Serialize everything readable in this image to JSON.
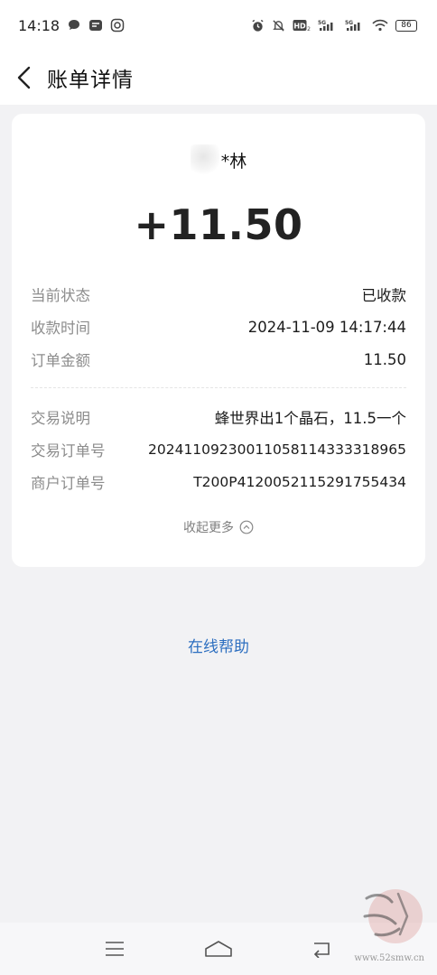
{
  "status_bar": {
    "time": "14:18",
    "battery": "86"
  },
  "header": {
    "title": "账单详情"
  },
  "merchant": {
    "name": "*林"
  },
  "amount": "+11.50",
  "details_top": [
    {
      "label": "当前状态",
      "value": "已收款"
    },
    {
      "label": "收款时间",
      "value": "2024-11-09 14:17:44"
    },
    {
      "label": "订单金额",
      "value": "11.50"
    }
  ],
  "details_bottom": [
    {
      "label": "交易说明",
      "value": "蜂世界出1个晶石，11.5一个"
    },
    {
      "label": "交易订单号",
      "value": "20241109230011058114333318965"
    },
    {
      "label": "商户订单号",
      "value": "T200P4120052115291755434"
    }
  ],
  "collapse_label": "收起更多",
  "help_link": "在线帮助",
  "watermark": {
    "site": "www.52smw.cn"
  },
  "colors": {
    "link": "#2d6fc0",
    "background": "#f2f2f4",
    "card": "#ffffff"
  }
}
